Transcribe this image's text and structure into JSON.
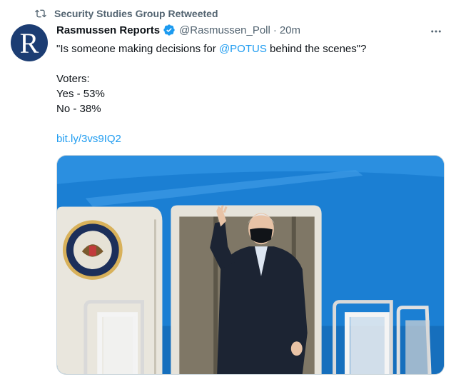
{
  "retweet": {
    "icon": "retweet-icon",
    "text": "Security Studies Group Retweeted"
  },
  "author": {
    "avatar_icon": "rasmussen-logo",
    "avatar_letter": "R",
    "name": "Rasmussen Reports",
    "verified_icon": "verified-badge-icon",
    "handle": "@Rasmussen_Poll",
    "separator": "·",
    "time": "20m"
  },
  "more_icon": "more-options-icon",
  "tweet": {
    "quote_open": "\"Is someone making decisions for ",
    "mention": "@POTUS",
    "quote_close": " behind the scenes\"?",
    "voters_label": "Voters:",
    "yes_line": "Yes - 53%",
    "no_line": "No - 38%",
    "link": "bit.ly/3vs9IQ2"
  },
  "media": {
    "description_icon": "photo-president-boarding-plane",
    "colors": {
      "plane_blue": "#1b7fd3",
      "plane_light": "#e9e6dd",
      "suit": "#1c2433"
    }
  }
}
